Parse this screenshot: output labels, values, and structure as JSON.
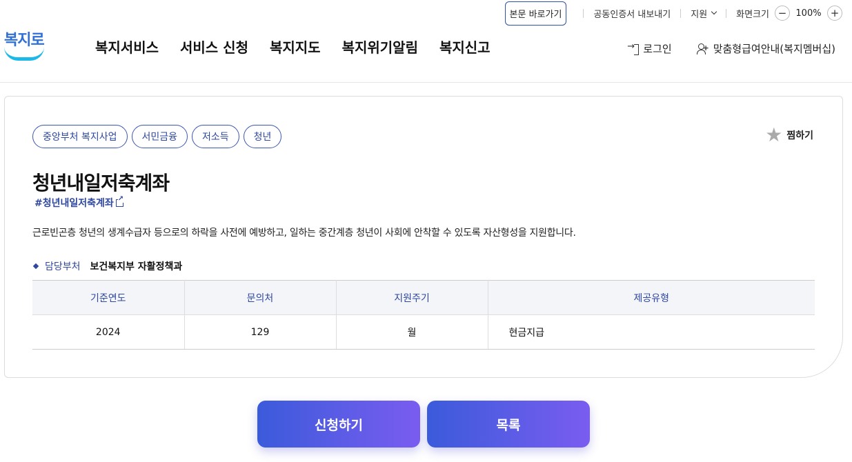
{
  "utility": {
    "skip_link": "본문 바로가기",
    "cert_export": "공동인증서 내보내기",
    "language": "지원",
    "zoom_label": "화면크기",
    "zoom_minus": "−",
    "zoom_value": "100%",
    "zoom_plus": "+"
  },
  "logo": {
    "text": "복지로"
  },
  "nav": {
    "items": [
      "복지서비스",
      "서비스 신청",
      "복지지도",
      "복지위기알림",
      "복지신고"
    ]
  },
  "header_right": {
    "login": "로그인",
    "membership": "맞춤형급여안내(복지멤버십)"
  },
  "detail": {
    "tags": [
      "중앙부처 복지사업",
      "서민금융",
      "저소득",
      "청년"
    ],
    "favorite_label": "찜하기",
    "title": "청년내일저축계좌",
    "hashtag": "#청년내일저축계좌",
    "description": "근로빈곤층 청년의 생계수급자 등으로의 하락을 사전에 예방하고, 일하는 중간계층 청년이 사회에 안착할 수 있도록 자산형성을 지원합니다.",
    "dept_label": "담당부처",
    "dept_value": "보건복지부 자활정책과",
    "table": {
      "headers": [
        "기준연도",
        "문의처",
        "지원주기",
        "제공유형"
      ],
      "row": [
        "2024",
        "129",
        "월",
        "현금지급"
      ]
    }
  },
  "actions": {
    "apply": "신청하기",
    "list": "목록"
  },
  "colors": {
    "brand_blue": "#2e47a0",
    "button_gradient_start": "#3b5bdb",
    "button_gradient_end": "#7a5cf0"
  }
}
